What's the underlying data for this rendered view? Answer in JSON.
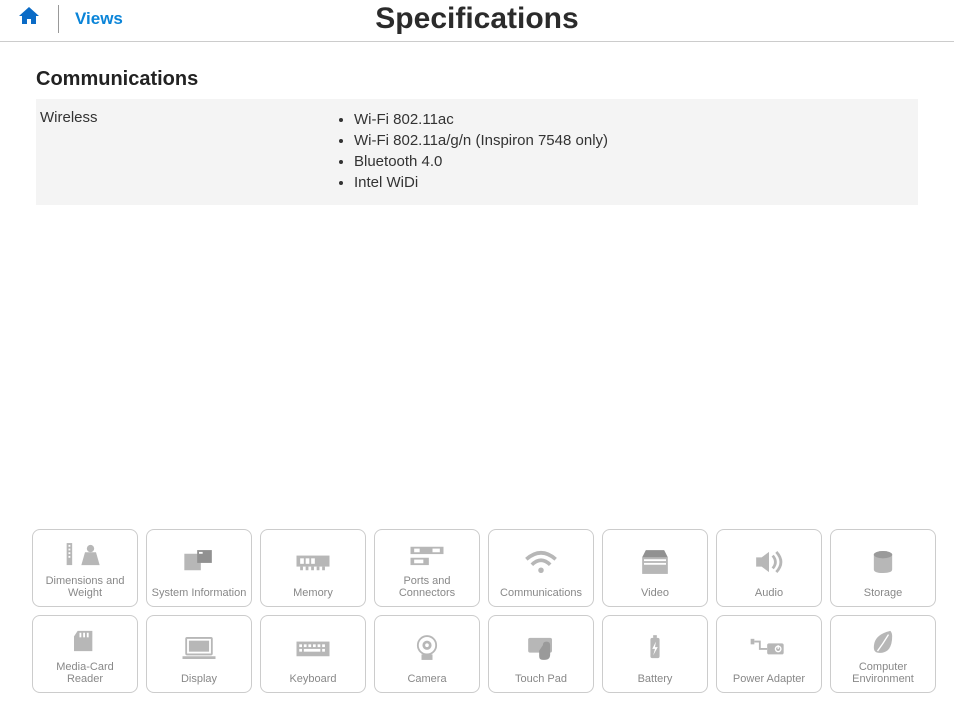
{
  "header": {
    "views_label": "Views",
    "page_title": "Specifications"
  },
  "section": {
    "title": "Communications",
    "row_label": "Wireless",
    "items": [
      "Wi-Fi 802.11ac",
      "Wi-Fi 802.11a/g/n (Inspiron 7548 only)",
      "Bluetooth 4.0",
      "Intel WiDi"
    ]
  },
  "nav": {
    "row1": [
      "Dimensions and Weight",
      "System Information",
      "Memory",
      "Ports and Connectors",
      "Communications",
      "Video",
      "Audio",
      "Storage"
    ],
    "row2": [
      "Media-Card Reader",
      "Display",
      "Keyboard",
      "Camera",
      "Touch Pad",
      "Battery",
      "Power Adapter",
      "Computer Environment"
    ]
  }
}
